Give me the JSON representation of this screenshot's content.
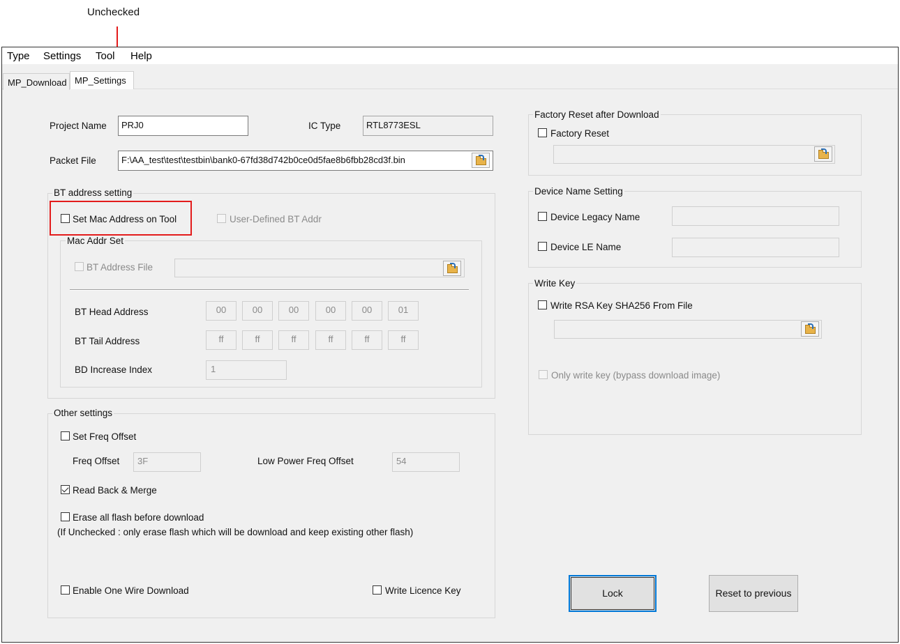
{
  "annotation": {
    "label": "Unchecked"
  },
  "menu": [
    "Type",
    "Settings",
    "Tool",
    "Help"
  ],
  "tabs": [
    "MP_Download",
    "MP_Settings"
  ],
  "project": {
    "project_name_label": "Project Name",
    "project_name_value": "PRJ0",
    "ic_type_label": "IC Type",
    "ic_type_value": "RTL8773ESL",
    "packet_file_label": "Packet File",
    "packet_file_value": "F:\\AA_test\\test\\testbin\\bank0-67fd38d742b0ce0d5fae8b6fbb28cd3f.bin"
  },
  "bt_address": {
    "group_title": "BT address setting",
    "set_mac_label": "Set Mac Address on Tool",
    "set_mac_checked": false,
    "user_defined_label": "User-Defined BT Addr",
    "mac_addr_set_title": "Mac Addr Set",
    "bt_address_file_label": "BT Address File",
    "bt_head_label": "BT Head Address",
    "bt_head_values": [
      "00",
      "00",
      "00",
      "00",
      "00",
      "01"
    ],
    "bt_tail_label": "BT Tail Address",
    "bt_tail_values": [
      "ff",
      "ff",
      "ff",
      "ff",
      "ff",
      "ff"
    ],
    "bd_increase_label": "BD Increase Index",
    "bd_increase_value": "1"
  },
  "other": {
    "group_title": "Other settings",
    "set_freq_label": "Set Freq Offset",
    "freq_offset_label": "Freq Offset",
    "freq_offset_value": "3F",
    "low_power_label": "Low Power Freq Offset",
    "low_power_value": "54",
    "read_back_label": "Read Back & Merge",
    "read_back_checked": true,
    "erase_all_label": "Erase all flash before download",
    "erase_note": "(If Unchecked : only erase flash which will be download and keep existing other flash)",
    "one_wire_label": "Enable One Wire Download",
    "licence_label": "Write Licence Key"
  },
  "factory": {
    "group_title": "Factory Reset after Download",
    "factory_reset_label": "Factory Reset"
  },
  "device_name": {
    "group_title": "Device Name Setting",
    "legacy_label": "Device Legacy Name",
    "le_label": "Device LE Name"
  },
  "write_key": {
    "group_title": "Write Key",
    "rsa_label": "Write RSA Key SHA256 From File",
    "only_write_label": "Only write key (bypass download image)"
  },
  "buttons": {
    "lock": "Lock",
    "reset": "Reset to previous"
  },
  "colors": {
    "annotation": "#e31b1b",
    "focus": "#0078d7",
    "window_bg": "#f0f0f0"
  },
  "icons": [
    "folder-open-icon",
    "checkbox-icon"
  ]
}
